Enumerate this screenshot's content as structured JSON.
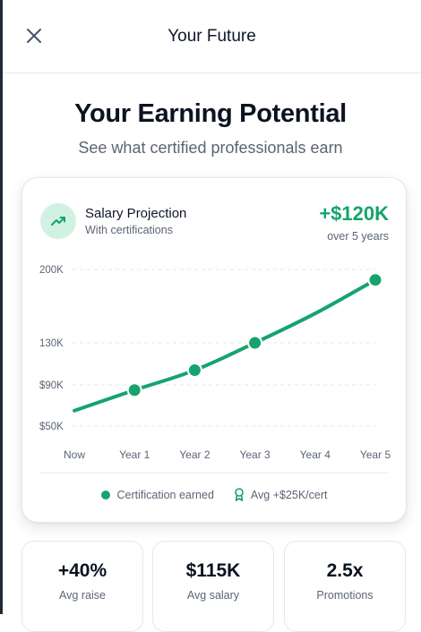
{
  "header": {
    "title": "Your Future",
    "close_icon": "close-icon"
  },
  "hero": {
    "title": "Your Earning Potential",
    "subtitle": "See what certified professionals earn"
  },
  "card": {
    "icon": "trending-up-icon",
    "title": "Salary Projection",
    "subtitle": "With certifications",
    "amount": "+$120K",
    "amount_note": "over 5 years",
    "legend": {
      "certification_label": "Certification earned",
      "award_icon": "award-icon",
      "avg_label": "Avg +$25K/cert"
    }
  },
  "chart_data": {
    "type": "line",
    "title": "",
    "xlabel": "",
    "ylabel": "",
    "categories": [
      "Now",
      "Year 1",
      "Year 2",
      "Year 3",
      "Year 4",
      "Year 5"
    ],
    "y_ticks": [
      {
        "label": "$50K",
        "value": 50
      },
      {
        "label": "$90K",
        "value": 90
      },
      {
        "label": "130K",
        "value": 130
      },
      {
        "label": "200K",
        "value": 200
      }
    ],
    "ylim": [
      50,
      200
    ],
    "series": [
      {
        "values": [
          65,
          85,
          104,
          130,
          158,
          190
        ],
        "markers": [
          false,
          true,
          true,
          true,
          false,
          true
        ]
      }
    ],
    "grid": true,
    "colors": {
      "line": "#16a36e",
      "grid": "#e5e7eb"
    }
  },
  "stats": [
    {
      "value": "+40%",
      "label": "Avg raise"
    },
    {
      "value": "$115K",
      "label": "Avg salary"
    },
    {
      "value": "2.5x",
      "label": "Promotions"
    }
  ],
  "colors": {
    "accent": "#16a36e",
    "accent_light": "#d1f2e3"
  }
}
